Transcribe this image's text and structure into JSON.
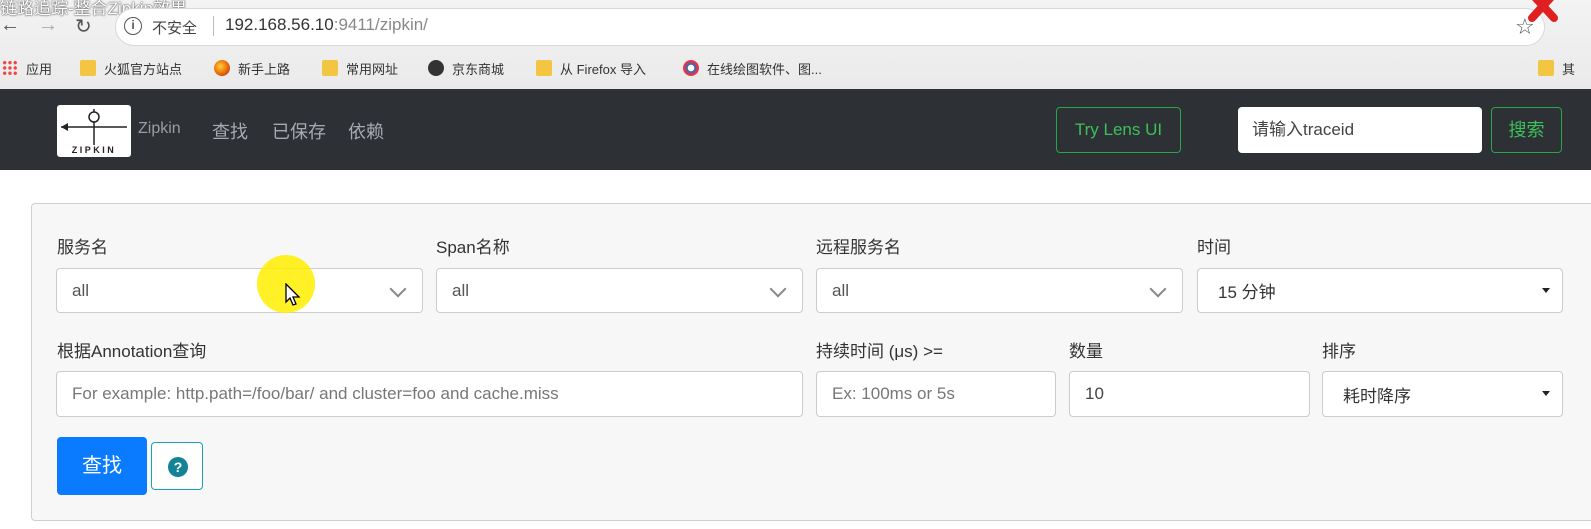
{
  "video_title": "链路追踪-整合Zipkin效果",
  "browser": {
    "security_label": "不安全",
    "url_host": "192.168.56.10",
    "url_rest": ":9411/zipkin/",
    "bookmarks": [
      {
        "label": "应用",
        "icon": "apps-grid-icon"
      },
      {
        "label": "火狐官方站点",
        "icon": "folder-icon"
      },
      {
        "label": "新手上路",
        "icon": "firefox-icon"
      },
      {
        "label": "常用网址",
        "icon": "folder-icon"
      },
      {
        "label": "京东商城",
        "icon": "globe-icon"
      },
      {
        "label": "从 Firefox 导入",
        "icon": "folder-icon"
      },
      {
        "label": "在线绘图软件、图...",
        "icon": "processon-icon"
      }
    ],
    "bookmark_overflow": "其"
  },
  "navbar": {
    "logo_text": "ZIPKIN",
    "brand": "Zipkin",
    "links": [
      "查找",
      "已保存",
      "依赖"
    ],
    "lens_button": "Try Lens UI",
    "traceid_placeholder": "请输入traceid",
    "search_button": "搜索"
  },
  "form": {
    "service_label": "服务名",
    "service_value": "all",
    "span_label": "Span名称",
    "span_value": "all",
    "remote_label": "远程服务名",
    "remote_value": "all",
    "time_label": "时间",
    "time_value": "15 分钟",
    "annotation_label": "根据Annotation查询",
    "annotation_placeholder": "For example: http.path=/foo/bar/ and cluster=foo and cache.miss",
    "duration_label": "持续时间 (μs) >=",
    "duration_placeholder": "Ex: 100ms or 5s",
    "limit_label": "数量",
    "limit_value": "10",
    "sort_label": "排序",
    "sort_value": "耗时降序",
    "find_button": "查找",
    "help_icon": "?"
  },
  "colors": {
    "navbar_bg": "#2d3035",
    "success_green": "#27a745",
    "primary_blue": "#0a7bff",
    "info_teal": "#138496"
  }
}
